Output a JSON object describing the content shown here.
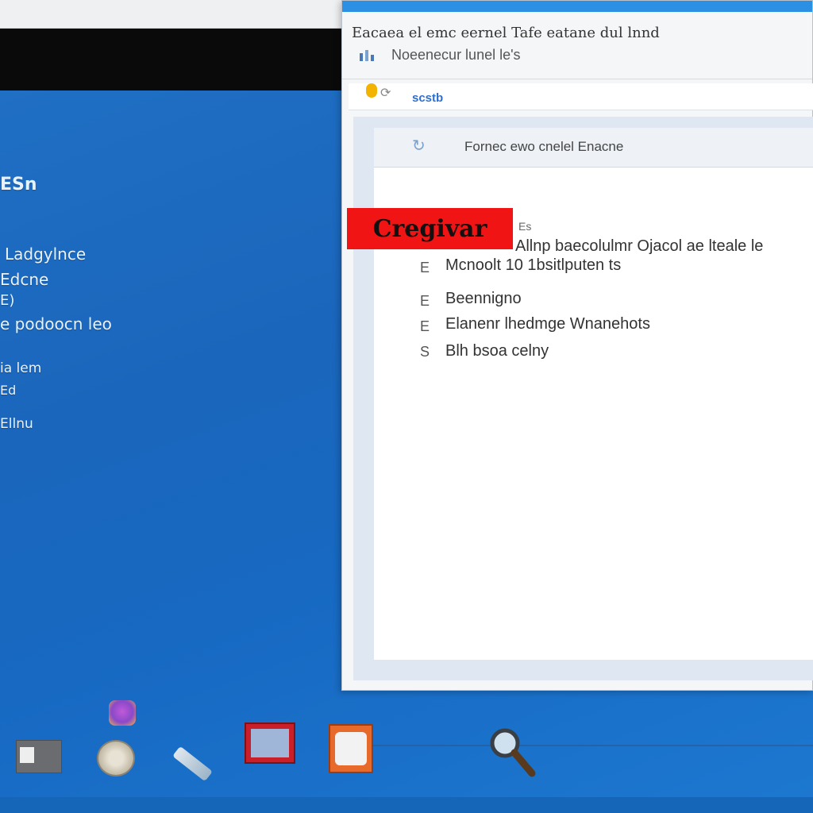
{
  "desktop": {
    "lines": {
      "heading": "ESn",
      "l1": "Ladgylnce",
      "l2": "Edcne",
      "l3": "E)",
      "l4": "e podoocn leo",
      "l5": "ia lem",
      "l6": "Ed",
      "l7": "Ellnu"
    }
  },
  "window": {
    "title": "Eacaea el emc eernel Tafe eatane dul lnnd",
    "subtitle_icon": "bar-chart-icon",
    "subtitle": "Noeenecur lunel le's",
    "address": {
      "icon": "browser-icon",
      "text": "scstb"
    },
    "panel": {
      "header_icon": "refresh-icon",
      "header_text": "Fornec ewo cnelel Enacne",
      "small_text": "Es",
      "items": [
        {
          "icon": "E",
          "text": "Allnp  baecolulmr Ojacol ae lteale le"
        },
        {
          "icon": "E",
          "text": "Mcnoolt 10 1bsitlputen  ts"
        },
        {
          "icon": "E",
          "text": "Beennigno"
        },
        {
          "icon": "E",
          "text": "Elanenr   lhedmge Wnanehots"
        },
        {
          "icon": "S",
          "text": "Blh bsoa   celny"
        }
      ]
    }
  },
  "overlay": {
    "label": "Cregivar",
    "color": "#f01414"
  },
  "taskbar": {
    "icons": [
      "app-icon",
      "folder-icon",
      "disk-icon",
      "pen-icon",
      "monitor-icon",
      "photo-icon",
      "search-icon"
    ]
  },
  "colors": {
    "desktop": "#1a6cc0",
    "titlebar_accent": "#2b8fe3",
    "link": "#2f6fcf"
  }
}
